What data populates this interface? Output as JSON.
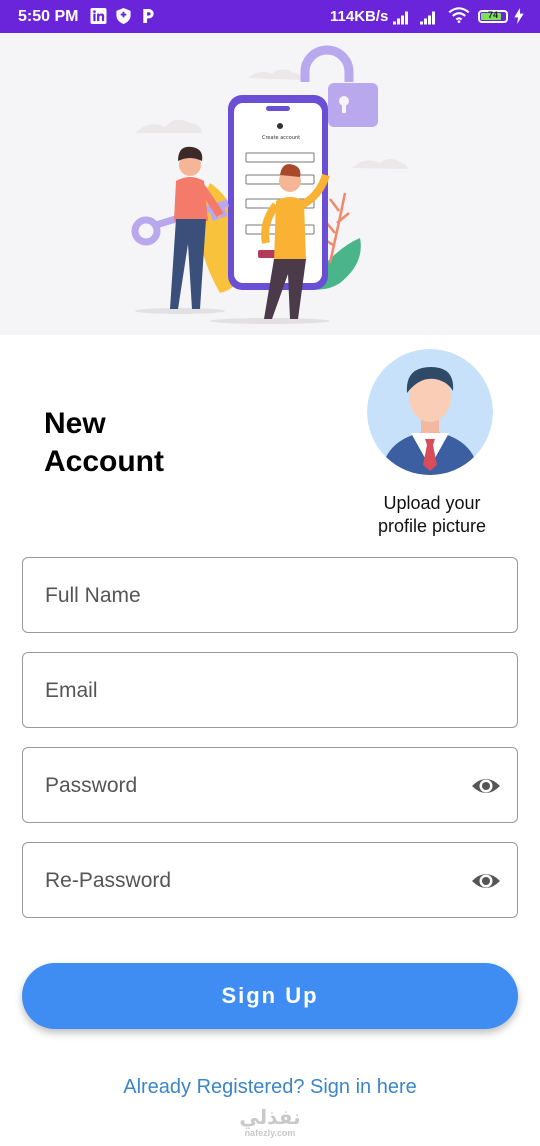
{
  "status_bar": {
    "time": "5:50 PM",
    "network_speed": "114KB/s",
    "battery_level": "74",
    "icons": [
      "linkedin-icon",
      "shield-icon",
      "p-app-icon",
      "signal-icon",
      "signal-icon",
      "wifi-icon",
      "battery-icon",
      "charging-icon"
    ],
    "background": "#6a24d9"
  },
  "hero": {
    "illustration": "create-account-illustration",
    "phone_screen_title": "Create account"
  },
  "page": {
    "title_line1": "New",
    "title_line2": "Account",
    "upload_line1": "Upload your",
    "upload_line2": "profile picture",
    "avatar_icon": "businessman-avatar-icon"
  },
  "form": {
    "full_name_placeholder": "Full Name",
    "email_placeholder": "Email",
    "password_placeholder": "Password",
    "repassword_placeholder": "Re-Password",
    "visibility_icon": "eye-icon"
  },
  "actions": {
    "signup_label": "Sign Up",
    "signin_link": "Already Registered? Sign in here",
    "primary_color": "#3f8df2",
    "link_color": "#3a86c8"
  },
  "watermark": {
    "arabic": "نفذلي",
    "latin": "nafezly.com"
  }
}
